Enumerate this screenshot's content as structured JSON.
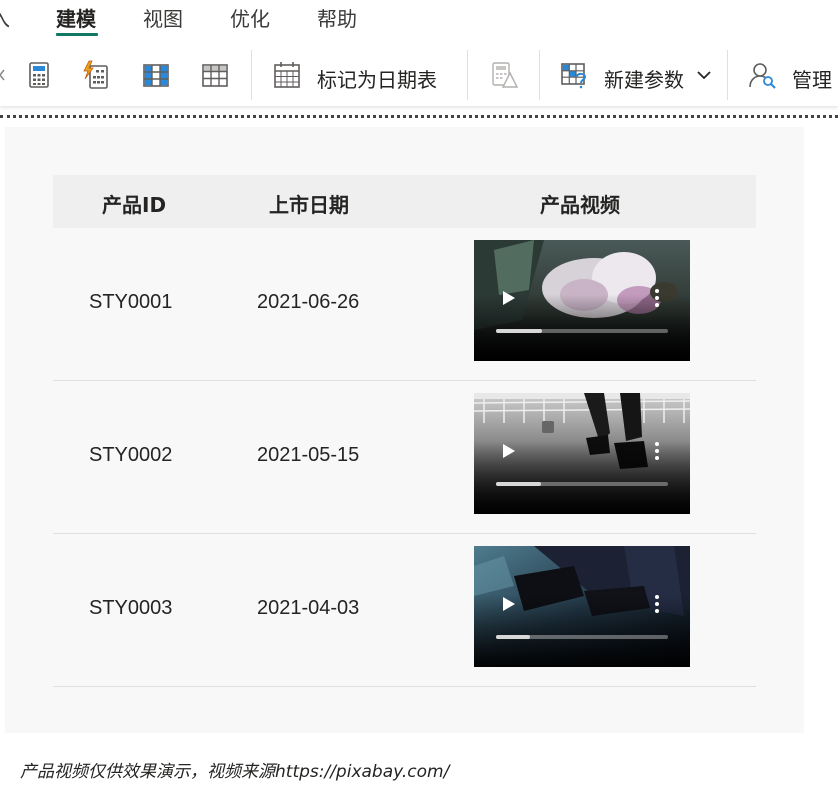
{
  "ribbon": {
    "tabs": [
      {
        "label": "入",
        "active": false
      },
      {
        "label": "建模",
        "active": true
      },
      {
        "label": "视图",
        "active": false
      },
      {
        "label": "优化",
        "active": false
      },
      {
        "label": "帮助",
        "active": false
      }
    ]
  },
  "toolbar": {
    "mark_date_table_label": "标记为日期表",
    "new_parameter_label": "新建参数",
    "manage_label": "管理"
  },
  "table": {
    "headers": [
      "产品ID",
      "上市日期",
      "产品视频"
    ],
    "rows": [
      {
        "product_id": "STY0001",
        "launch_date": "2021-06-26",
        "video_progress": 0.27
      },
      {
        "product_id": "STY0002",
        "launch_date": "2021-05-15",
        "video_progress": 0.26
      },
      {
        "product_id": "STY0003",
        "launch_date": "2021-04-03",
        "video_progress": 0.2
      }
    ]
  },
  "footnote": "产品视频仅供效果演示，视频来源https://pixabay.com/",
  "colors": {
    "accent": "#117865",
    "icon_blue": "#2b88d8",
    "icon_gray": "#605e5c",
    "icon_orange": "#e8a317"
  }
}
